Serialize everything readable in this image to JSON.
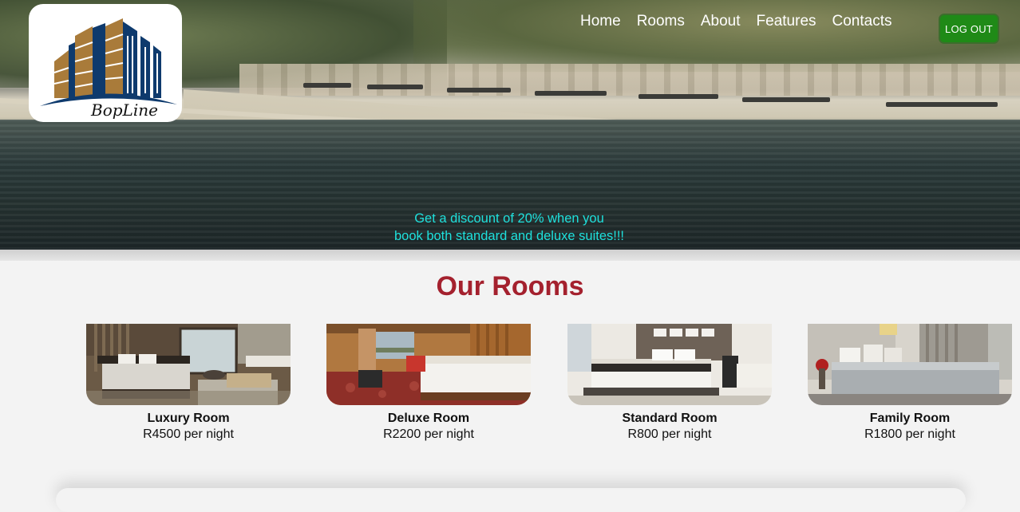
{
  "brand": {
    "logo_text": "BopLine"
  },
  "nav": {
    "items": [
      "Home",
      "Rooms",
      "About",
      "Features",
      "Contacts"
    ]
  },
  "auth": {
    "logout_label": "LOG OUT"
  },
  "promo": {
    "line1": "Get a discount of 20% when you",
    "line2": "book both standard and deluxe suites!!!"
  },
  "rooms_section": {
    "title": "Our Rooms",
    "rooms": [
      {
        "name": "Luxury Room",
        "price": "R4500 per night"
      },
      {
        "name": "Deluxe Room",
        "price": "R2200 per night"
      },
      {
        "name": "Standard Room",
        "price": "R800 per night"
      },
      {
        "name": "Family Room",
        "price": "R1800 per night"
      }
    ]
  },
  "colors": {
    "title_red": "#a4212e",
    "promo_cyan": "#1fe0dc",
    "logout_green": "#1f8a17",
    "logo_navy": "#0e3a6d",
    "logo_gold": "#a97b3a"
  }
}
